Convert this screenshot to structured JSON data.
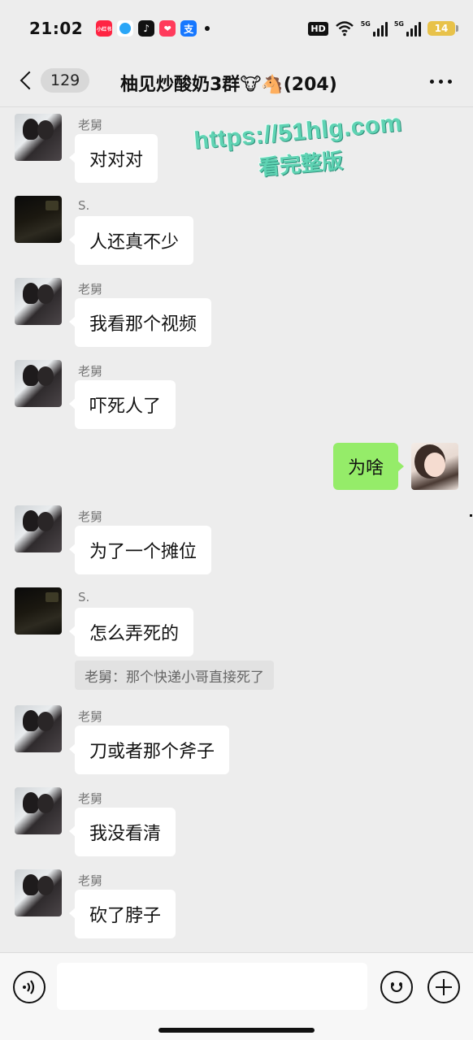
{
  "status_bar": {
    "time": "21:02",
    "app_badges": [
      {
        "name": "xiaohongshu-icon",
        "label": "小红书",
        "color": "#ff2442"
      },
      {
        "name": "bubble-app-icon",
        "label": "",
        "color": "#2aa6f7"
      },
      {
        "name": "douyin-icon",
        "label": "♪",
        "color": "#111111"
      },
      {
        "name": "heart-app-icon",
        "label": "❤",
        "color": "#ff3b5c"
      },
      {
        "name": "alipay-icon",
        "label": "支",
        "color": "#1677ff"
      }
    ],
    "hd_label": "HD",
    "signal_labels": [
      "5G",
      "5G"
    ],
    "battery": "14"
  },
  "header": {
    "unread_count": "129",
    "title": "柚见炒酸奶3群🐮🐴(204)"
  },
  "watermark": {
    "url": "https://51hlg.com",
    "subtitle": "看完整版"
  },
  "messages": [
    {
      "sender": "老舅",
      "text": "对对对",
      "avatar": "couple"
    },
    {
      "sender": "S.",
      "text": "人还真不少",
      "avatar": "dark"
    },
    {
      "sender": "老舅",
      "text": "我看那个视频",
      "avatar": "couple"
    },
    {
      "sender": "老舅",
      "text": "吓死人了",
      "avatar": "couple"
    },
    {
      "sender": "",
      "text": "为啥",
      "avatar": "self"
    },
    {
      "sender": "老舅",
      "text": "为了一个摊位",
      "avatar": "couple"
    },
    {
      "sender": "S.",
      "text": "怎么弄死的",
      "avatar": "dark",
      "quote": "老舅：那个快递小哥直接死了"
    },
    {
      "sender": "老舅",
      "text": "刀或者那个斧子",
      "avatar": "couple"
    },
    {
      "sender": "老舅",
      "text": "我没看清",
      "avatar": "couple"
    },
    {
      "sender": "老舅",
      "text": "砍了脖子",
      "avatar": "couple"
    }
  ],
  "input_bar": {
    "placeholder": ""
  }
}
